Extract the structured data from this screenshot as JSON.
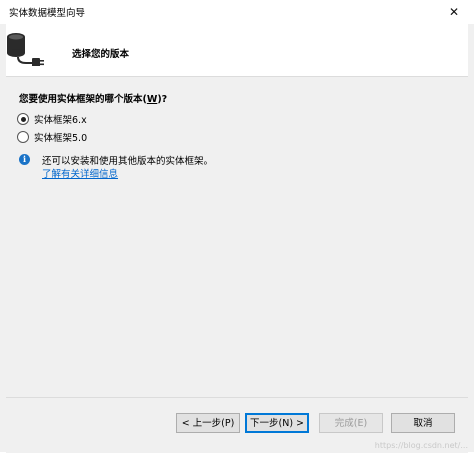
{
  "window": {
    "title": "实体数据模型向导",
    "close_glyph": "✕"
  },
  "header": {
    "title": "选择您的版本",
    "icon": "database-connector-icon"
  },
  "question": {
    "text_before": "您要使用实体框架的哪个版本(",
    "accelerator": "W",
    "text_after": ")?"
  },
  "options": [
    {
      "label": "实体框架6.x",
      "selected": true
    },
    {
      "label": "实体框架5.0",
      "selected": false
    }
  ],
  "info": {
    "icon": "info-icon",
    "text": "还可以安装和使用其他版本的实体框架。",
    "link": "了解有关详细信息"
  },
  "buttons": {
    "back": "< 上一步(P)",
    "next": "下一步(N) >",
    "finish": "完成(E)",
    "cancel": "取消"
  },
  "colors": {
    "accent": "#0078d7",
    "link": "#0066cc",
    "info": "#1a73c7"
  },
  "watermark": "https://blog.csdn.net/..."
}
